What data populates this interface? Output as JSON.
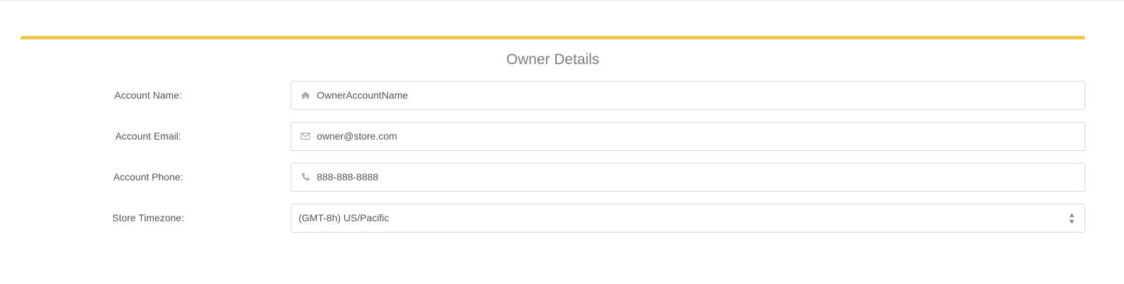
{
  "panel": {
    "title": "Owner Details",
    "accent_color": "#ecc94b"
  },
  "fields": [
    {
      "label": "Account Name:",
      "value": "OwnerAccountName",
      "icon": "home-icon"
    },
    {
      "label": "Account Email:",
      "value": "owner@store.com",
      "icon": "envelope-icon"
    },
    {
      "label": "Account Phone:",
      "value": "888-888-8888",
      "icon": "phone-icon"
    }
  ],
  "timezone": {
    "label": "Store Timezone:",
    "selected": "(GMT-8h) US/Pacific",
    "icon": "select-arrows-icon"
  }
}
